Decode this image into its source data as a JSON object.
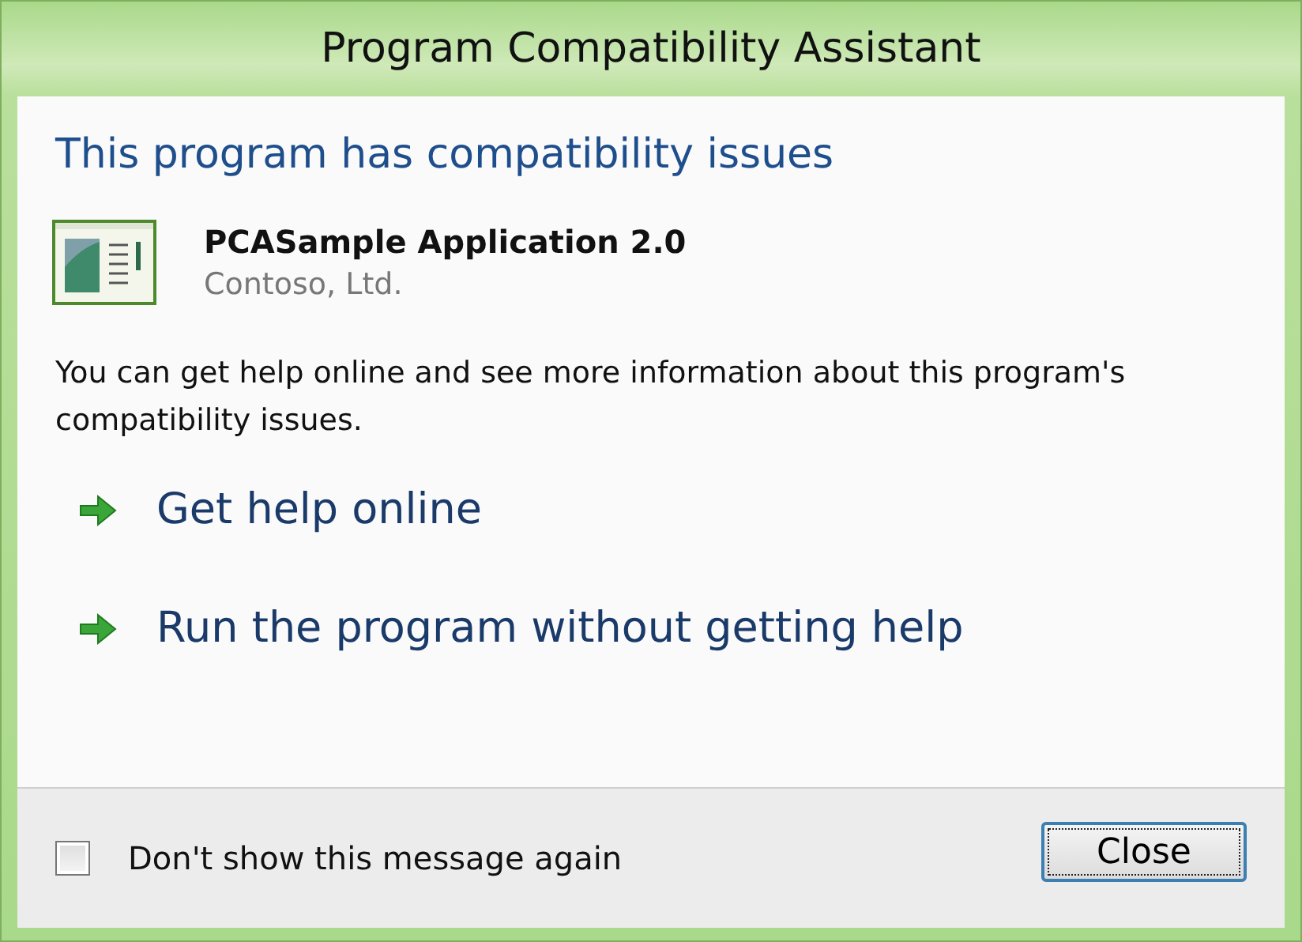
{
  "window": {
    "title": "Program Compatibility Assistant"
  },
  "heading": "This program has compatibility issues",
  "program": {
    "name": "PCASample Application 2.0",
    "publisher": "Contoso, Ltd."
  },
  "message": "You can get help online and see more information about this program's compatibility issues.",
  "actions": [
    {
      "label": "Get help online"
    },
    {
      "label": "Run the program without getting help"
    }
  ],
  "footer": {
    "checkbox": {
      "label": "Don't show this message again",
      "checked": false
    },
    "button": {
      "label": "Close",
      "focused": true
    }
  }
}
